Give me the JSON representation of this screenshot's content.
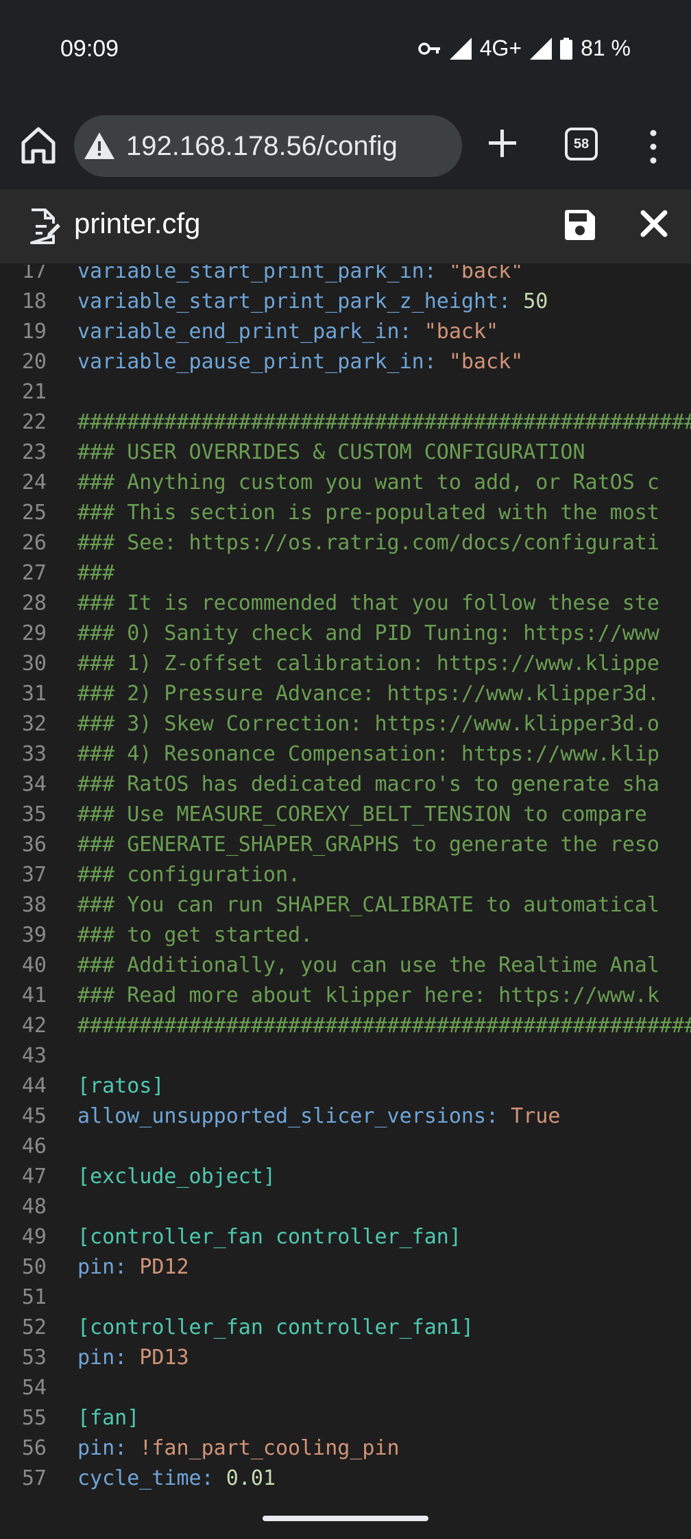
{
  "status_bar": {
    "time": "09:09",
    "network": "4G+",
    "battery": "81 %",
    "icons": [
      "vpn-key-icon",
      "signal-icon",
      "signal-icon",
      "battery-icon"
    ]
  },
  "browser": {
    "url": "192.168.178.56/config",
    "tab_count": "58",
    "icons": [
      "home-icon",
      "warning-icon",
      "plus-icon",
      "tabs-icon",
      "more-vert-icon"
    ]
  },
  "file": {
    "title": "printer.cfg",
    "icons": [
      "file-edit-icon",
      "save-icon",
      "close-icon"
    ]
  },
  "colors": {
    "key": "#6fa5d8",
    "string": "#d29478",
    "number": "#c5dcb0",
    "section": "#4ec9b0",
    "comment": "#6a9e52",
    "line_number": "#8a8a8a"
  },
  "editor": {
    "lines": [
      {
        "n": "17",
        "parts": [
          {
            "t": "key",
            "v": "variable_start_print_park_in: "
          },
          {
            "t": "str",
            "v": "\"back\""
          }
        ]
      },
      {
        "n": "18",
        "parts": [
          {
            "t": "key",
            "v": "variable_start_print_park_z_height: "
          },
          {
            "t": "num",
            "v": "50"
          }
        ]
      },
      {
        "n": "19",
        "parts": [
          {
            "t": "key",
            "v": "variable_end_print_park_in: "
          },
          {
            "t": "str",
            "v": "\"back\""
          }
        ]
      },
      {
        "n": "20",
        "parts": [
          {
            "t": "key",
            "v": "variable_pause_print_park_in: "
          },
          {
            "t": "str",
            "v": "\"back\""
          }
        ]
      },
      {
        "n": "21",
        "parts": []
      },
      {
        "n": "22",
        "parts": [
          {
            "t": "com",
            "v": "##################################################"
          }
        ]
      },
      {
        "n": "23",
        "parts": [
          {
            "t": "com",
            "v": "### USER OVERRIDES & CUSTOM CONFIGURATION"
          }
        ]
      },
      {
        "n": "24",
        "parts": [
          {
            "t": "com",
            "v": "### Anything custom you want to add, or RatOS c"
          }
        ]
      },
      {
        "n": "25",
        "parts": [
          {
            "t": "com",
            "v": "### This section is pre-populated with the most"
          }
        ]
      },
      {
        "n": "26",
        "parts": [
          {
            "t": "com",
            "v": "### See: https://os.ratrig.com/docs/configurati"
          }
        ]
      },
      {
        "n": "27",
        "parts": [
          {
            "t": "com",
            "v": "###"
          }
        ]
      },
      {
        "n": "28",
        "parts": [
          {
            "t": "com",
            "v": "### It is recommended that you follow these ste"
          }
        ]
      },
      {
        "n": "29",
        "parts": [
          {
            "t": "com",
            "v": "### 0) Sanity check and PID Tuning: https://www"
          }
        ]
      },
      {
        "n": "30",
        "parts": [
          {
            "t": "com",
            "v": "### 1) Z-offset calibration: https://www.klippe"
          }
        ]
      },
      {
        "n": "31",
        "parts": [
          {
            "t": "com",
            "v": "### 2) Pressure Advance: https://www.klipper3d."
          }
        ]
      },
      {
        "n": "32",
        "parts": [
          {
            "t": "com",
            "v": "### 3) Skew Correction: https://www.klipper3d.o"
          }
        ]
      },
      {
        "n": "33",
        "parts": [
          {
            "t": "com",
            "v": "### 4) Resonance Compensation: https://www.klip"
          }
        ]
      },
      {
        "n": "34",
        "parts": [
          {
            "t": "com",
            "v": "### RatOS has dedicated macro's to generate sha"
          }
        ]
      },
      {
        "n": "35",
        "parts": [
          {
            "t": "com",
            "v": "### Use MEASURE_COREXY_BELT_TENSION to compare "
          }
        ]
      },
      {
        "n": "36",
        "parts": [
          {
            "t": "com",
            "v": "### GENERATE_SHAPER_GRAPHS to generate the reso"
          }
        ]
      },
      {
        "n": "37",
        "parts": [
          {
            "t": "com",
            "v": "### configuration."
          }
        ]
      },
      {
        "n": "38",
        "parts": [
          {
            "t": "com",
            "v": "### You can run SHAPER_CALIBRATE to automatical"
          }
        ]
      },
      {
        "n": "39",
        "parts": [
          {
            "t": "com",
            "v": "### to get started."
          }
        ]
      },
      {
        "n": "40",
        "parts": [
          {
            "t": "com",
            "v": "### Additionally, you can use the Realtime Anal"
          }
        ]
      },
      {
        "n": "41",
        "parts": [
          {
            "t": "com",
            "v": "### Read more about klipper here: https://www.k"
          }
        ]
      },
      {
        "n": "42",
        "parts": [
          {
            "t": "com",
            "v": "##################################################"
          }
        ]
      },
      {
        "n": "43",
        "parts": []
      },
      {
        "n": "44",
        "parts": [
          {
            "t": "sec",
            "v": "[ratos]"
          }
        ]
      },
      {
        "n": "45",
        "parts": [
          {
            "t": "key",
            "v": "allow_unsupported_slicer_versions: "
          },
          {
            "t": "val",
            "v": "True"
          }
        ]
      },
      {
        "n": "46",
        "parts": []
      },
      {
        "n": "47",
        "parts": [
          {
            "t": "sec",
            "v": "[exclude_object]"
          }
        ]
      },
      {
        "n": "48",
        "parts": []
      },
      {
        "n": "49",
        "parts": [
          {
            "t": "sec",
            "v": "[controller_fan controller_fan]"
          }
        ]
      },
      {
        "n": "50",
        "parts": [
          {
            "t": "key",
            "v": "pin: "
          },
          {
            "t": "val",
            "v": "PD12"
          }
        ]
      },
      {
        "n": "51",
        "parts": []
      },
      {
        "n": "52",
        "parts": [
          {
            "t": "sec",
            "v": "[controller_fan controller_fan1]"
          }
        ]
      },
      {
        "n": "53",
        "parts": [
          {
            "t": "key",
            "v": "pin: "
          },
          {
            "t": "val",
            "v": "PD13"
          }
        ]
      },
      {
        "n": "54",
        "parts": []
      },
      {
        "n": "55",
        "parts": [
          {
            "t": "sec",
            "v": "[fan]"
          }
        ]
      },
      {
        "n": "56",
        "parts": [
          {
            "t": "key",
            "v": "pin: "
          },
          {
            "t": "val",
            "v": "!fan_part_cooling_pin"
          }
        ]
      },
      {
        "n": "57",
        "parts": [
          {
            "t": "key",
            "v": "cycle_time: "
          },
          {
            "t": "num",
            "v": "0.01"
          }
        ]
      }
    ]
  }
}
